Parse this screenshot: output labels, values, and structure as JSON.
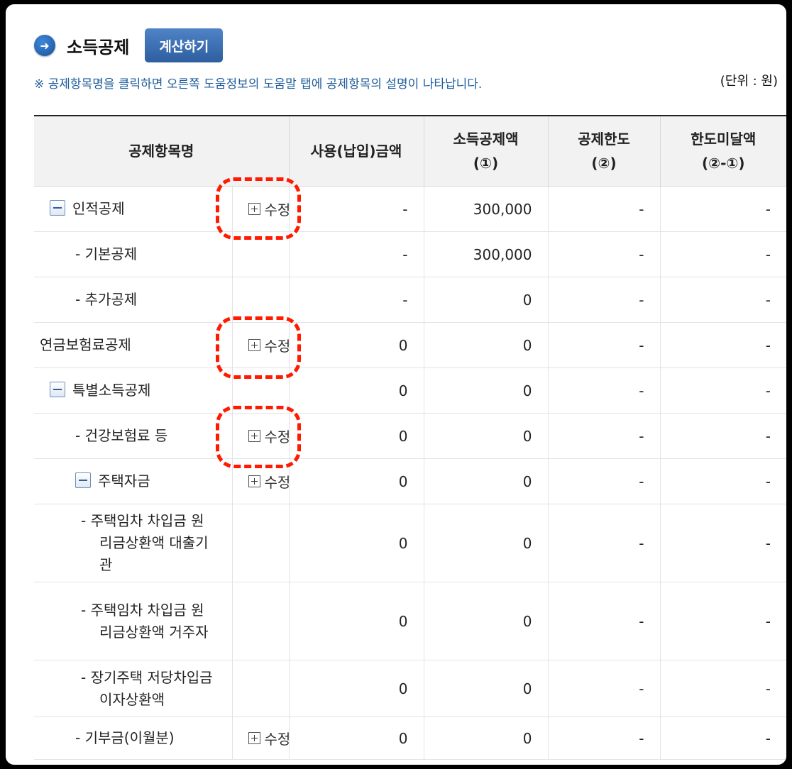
{
  "header": {
    "title": "소득공제",
    "calc_button": "계산하기"
  },
  "notice": "※ 공제항목명을 클릭하면 오른쪽 도움정보의 도움말 탭에 공제항목의 설명이 나타납니다.",
  "unit": "(단위 : 원)",
  "columns": {
    "name": "공제항목명",
    "used": "사용(납입)금액",
    "deduction_l1": "소득공제액",
    "deduction_l2": "(①)",
    "limit_l1": "공제한도",
    "limit_l2": "(②)",
    "remain_l1": "한도미달액",
    "remain_l2": "(②-①)"
  },
  "edit_label": "수정",
  "rows": [
    {
      "name": "인적공제",
      "used": "-",
      "deduction": "300,000",
      "limit": "-",
      "remain": "-"
    },
    {
      "name": "- 기본공제",
      "used": "-",
      "deduction": "300,000",
      "limit": "-",
      "remain": "-"
    },
    {
      "name": "- 추가공제",
      "used": "-",
      "deduction": "0",
      "limit": "-",
      "remain": "-"
    },
    {
      "name": "연금보험료공제",
      "used": "0",
      "deduction": "0",
      "limit": "-",
      "remain": "-"
    },
    {
      "name": "특별소득공제",
      "used": "0",
      "deduction": "0",
      "limit": "-",
      "remain": "-"
    },
    {
      "name": "- 건강보험료 등",
      "used": "0",
      "deduction": "0",
      "limit": "-",
      "remain": "-"
    },
    {
      "name": "주택자금",
      "used": "0",
      "deduction": "0",
      "limit": "-",
      "remain": "-"
    },
    {
      "name": "- 주택임차 차입금 원리금상환액 대출기관",
      "used": "0",
      "deduction": "0",
      "limit": "-",
      "remain": "-"
    },
    {
      "name": "- 주택임차 차입금 원리금상환액 거주자",
      "used": "0",
      "deduction": "0",
      "limit": "-",
      "remain": "-"
    },
    {
      "name": "- 장기주택 저당차입금 이자상환액",
      "used": "0",
      "deduction": "0",
      "limit": "-",
      "remain": "-"
    },
    {
      "name": "- 기부금(이월분)",
      "used": "0",
      "deduction": "0",
      "limit": "-",
      "remain": "-"
    }
  ]
}
